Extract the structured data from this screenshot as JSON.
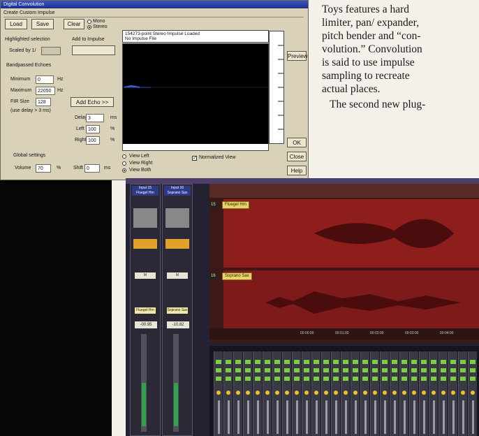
{
  "dialog": {
    "title": "Digital Convolution",
    "menu": "Create Custom Impulse",
    "load": "Load",
    "save": "Save",
    "clear": "Clear",
    "mono": "Mono",
    "stereo": "Stereo",
    "info_line1": "154273-point Stereo Impulse Loaded",
    "info_line2": "No Impulse File",
    "highlighted_selection": "Highlighted selection",
    "add_to_impulse": "Add to Impulse",
    "scaled_by": "Scaled by 1/",
    "bandpassed_echoes": "Bandpassed Echoes",
    "minimum_label": "Minimum",
    "minimum_value": "0",
    "minimum_unit": "Hz",
    "maximum_label": "Maximum",
    "maximum_value": "22050",
    "maximum_unit": "Hz",
    "fir_size_label": "FIR Size",
    "fir_size_value": "128",
    "fir_note": "(use delay > 3 ms)",
    "add_echo": "Add Echo >>",
    "delay_label": "Delay",
    "delay_value": "3",
    "delay_unit": "ms",
    "left_label": "Left",
    "left_value": "100",
    "left_unit": "%",
    "right_label": "Right",
    "right_value": "100",
    "right_unit": "%",
    "global_settings": "Global settings",
    "volume_label": "Volume",
    "volume_value": "70",
    "volume_unit": "%",
    "shift_label": "Shift",
    "shift_value": "0",
    "shift_unit": "ms",
    "view_left": "View Left",
    "view_right": "View Right",
    "view_both": "View Both",
    "normalized_view": "Normalized View",
    "preview": "Preview",
    "ok": "OK",
    "close": "Close",
    "help": "Help"
  },
  "article": {
    "lines": [
      "Toys features a hard",
      "limiter, pan/ expander,",
      "pitch bender and “con-",
      "volution.” Convolution",
      "is said to use impulse",
      "sampling to recreate",
      "actual places.",
      "The second new plug-"
    ]
  },
  "daw": {
    "strip1": {
      "name_line1": "Input 15",
      "name_line2": "Fluegel Hrn",
      "insert": "Fluegel Hrn",
      "value": "-00.95"
    },
    "strip2": {
      "name_line1": "Input 16",
      "name_line2": "Soprano Sax",
      "insert": "Soprano Sax",
      "value": "-10.82"
    },
    "track1_label": "Fluegel Hrn",
    "track2_label": "Soprano Sax",
    "track1_num": "15",
    "track2_num": "16",
    "ruler_ticks": [
      "00:00:00",
      "00:01:00",
      "00:02:00",
      "00:03:00",
      "00:04:00"
    ]
  },
  "colors": {
    "title_bar": "#1b2f8c",
    "waveform": "#5a0e10",
    "fader_green": "#2fa34a"
  }
}
